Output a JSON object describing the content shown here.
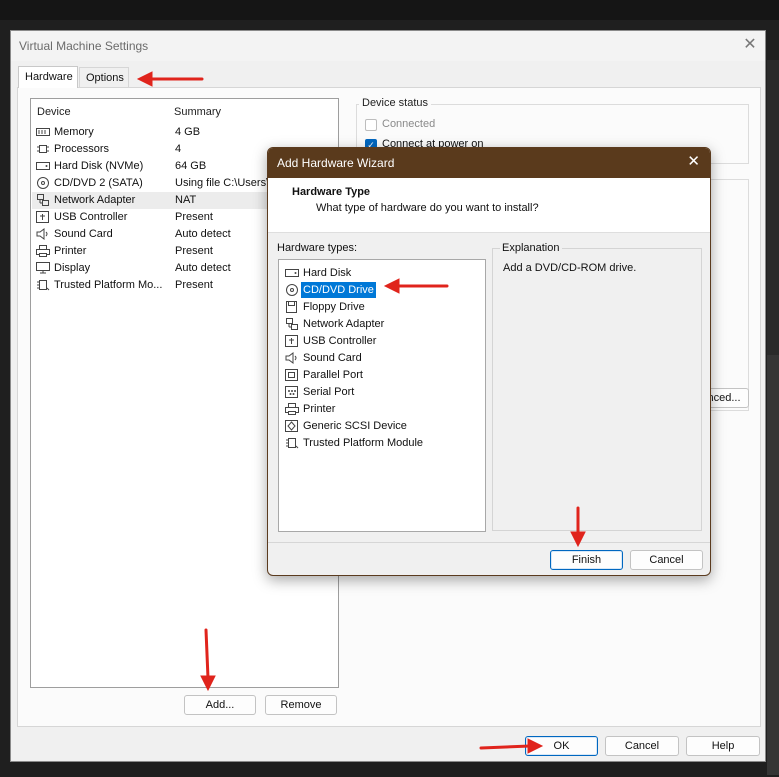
{
  "vm_dialog": {
    "title": "Virtual Machine Settings",
    "tabs": [
      {
        "label": "Hardware",
        "active": true
      },
      {
        "label": "Options",
        "active": false
      }
    ],
    "device_list": {
      "columns": [
        "Device",
        "Summary"
      ],
      "rows": [
        {
          "icon": "memory-icon",
          "name": "Memory",
          "summary": "4 GB"
        },
        {
          "icon": "processor-icon",
          "name": "Processors",
          "summary": "4"
        },
        {
          "icon": "hard-disk-icon",
          "name": "Hard Disk (NVMe)",
          "summary": "64 GB"
        },
        {
          "icon": "cd-dvd-icon",
          "name": "CD/DVD 2 (SATA)",
          "summary": "Using file C:\\Users\\"
        },
        {
          "icon": "network-adapter-icon",
          "name": "Network Adapter",
          "summary": "NAT",
          "selected": true
        },
        {
          "icon": "usb-icon",
          "name": "USB Controller",
          "summary": "Present"
        },
        {
          "icon": "speaker-icon",
          "name": "Sound Card",
          "summary": "Auto detect"
        },
        {
          "icon": "printer-icon",
          "name": "Printer",
          "summary": "Present"
        },
        {
          "icon": "display-icon",
          "name": "Display",
          "summary": "Auto detect"
        },
        {
          "icon": "tpm-icon",
          "name": "Trusted Platform Mo...",
          "summary": "Present"
        }
      ]
    },
    "device_status": {
      "title": "Device status",
      "connected_label": "Connected",
      "connected_checked": false,
      "connect_power_on_label": "Connect at power on",
      "connect_power_on_checked": true
    },
    "advanced_button_label": "nced...",
    "add_button_label": "Add...",
    "remove_button_label": "Remove",
    "ok_button_label": "OK",
    "cancel_button_label": "Cancel",
    "help_button_label": "Help"
  },
  "wizard": {
    "title": "Add Hardware Wizard",
    "heading": "Hardware Type",
    "subheading": "What type of hardware do you want to install?",
    "types_label": "Hardware types:",
    "explanation_label": "Explanation",
    "explanation_text": "Add a DVD/CD-ROM drive.",
    "types": [
      {
        "icon": "hard-disk-icon",
        "label": "Hard Disk"
      },
      {
        "icon": "cd-dvd-icon",
        "label": "CD/DVD Drive",
        "selected": true
      },
      {
        "icon": "floppy-icon",
        "label": "Floppy Drive"
      },
      {
        "icon": "network-adapter-icon",
        "label": "Network Adapter"
      },
      {
        "icon": "usb-icon",
        "label": "USB Controller"
      },
      {
        "icon": "speaker-icon",
        "label": "Sound Card"
      },
      {
        "icon": "parallel-port-icon",
        "label": "Parallel Port"
      },
      {
        "icon": "serial-port-icon",
        "label": "Serial Port"
      },
      {
        "icon": "printer-icon",
        "label": "Printer"
      },
      {
        "icon": "scsi-icon",
        "label": "Generic SCSI Device"
      },
      {
        "icon": "tpm-icon",
        "label": "Trusted Platform Module"
      }
    ],
    "finish_button_label": "Finish",
    "cancel_button_label": "Cancel",
    "title_bar_color": "#5a3a1c"
  },
  "annotation_color": "#e0241c"
}
